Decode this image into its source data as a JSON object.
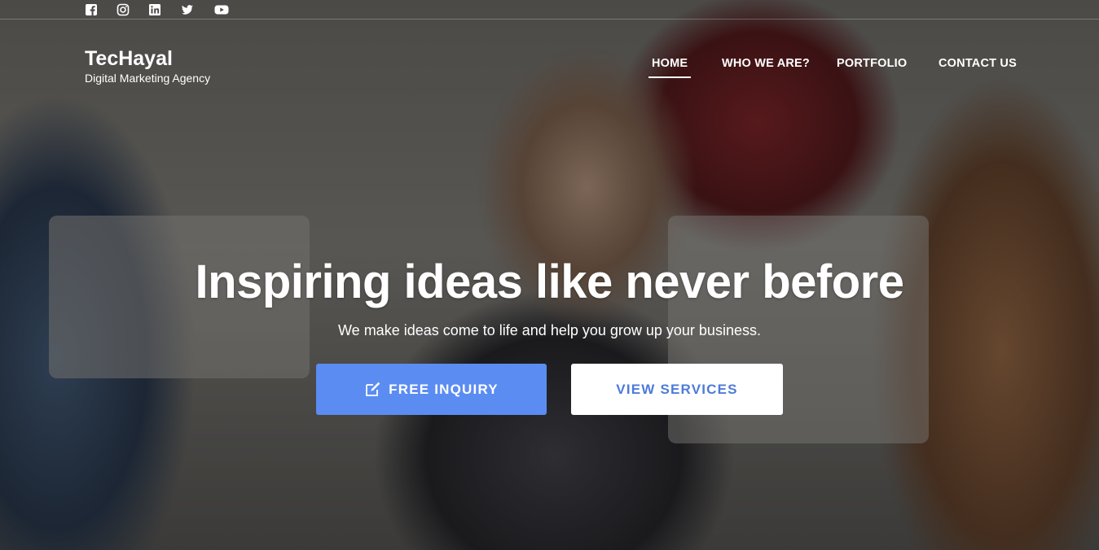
{
  "social": {
    "icons": [
      "facebook-icon",
      "instagram-icon",
      "linkedin-icon",
      "twitter-icon",
      "youtube-icon"
    ]
  },
  "brand": {
    "name": "TecHayal",
    "tagline": "Digital Marketing Agency"
  },
  "nav": {
    "items": [
      {
        "label": "HOME",
        "active": true
      },
      {
        "label": "WHO WE ARE?",
        "active": false
      },
      {
        "label": "PORTFOLIO",
        "active": false
      },
      {
        "label": "CONTACT US",
        "active": false
      }
    ]
  },
  "hero": {
    "headline": "Inspiring ideas like never before",
    "subheadline": "We make ideas come to life and help you grow up your business.",
    "primary_button": {
      "label": "FREE INQUIRY",
      "icon": "edit-icon"
    },
    "secondary_button": {
      "label": "VIEW SERVICES"
    }
  },
  "colors": {
    "primary_button_bg": "#5b8cf2",
    "secondary_button_text": "#4d7bd9",
    "overlay": "rgba(0,0,0,0.38)"
  }
}
